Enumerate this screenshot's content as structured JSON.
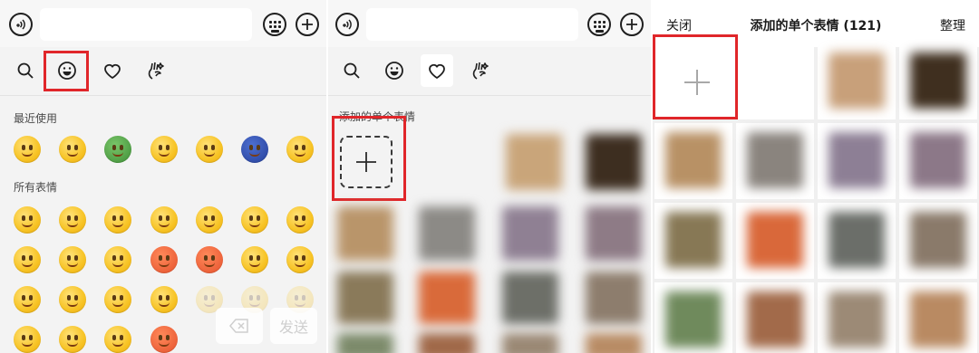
{
  "left_panel": {
    "section_recent": "最近使用",
    "section_all": "所有表情",
    "delete_icon": "backspace-icon",
    "send_label": "发送"
  },
  "middle_panel": {
    "section_added": "添加的单个表情"
  },
  "right_panel": {
    "close_label": "关闭",
    "title": "添加的单个表情 (121)",
    "manage_label": "整理"
  },
  "colors": {
    "highlight": "#e0262a",
    "panel_bg": "#f3f3f3"
  }
}
